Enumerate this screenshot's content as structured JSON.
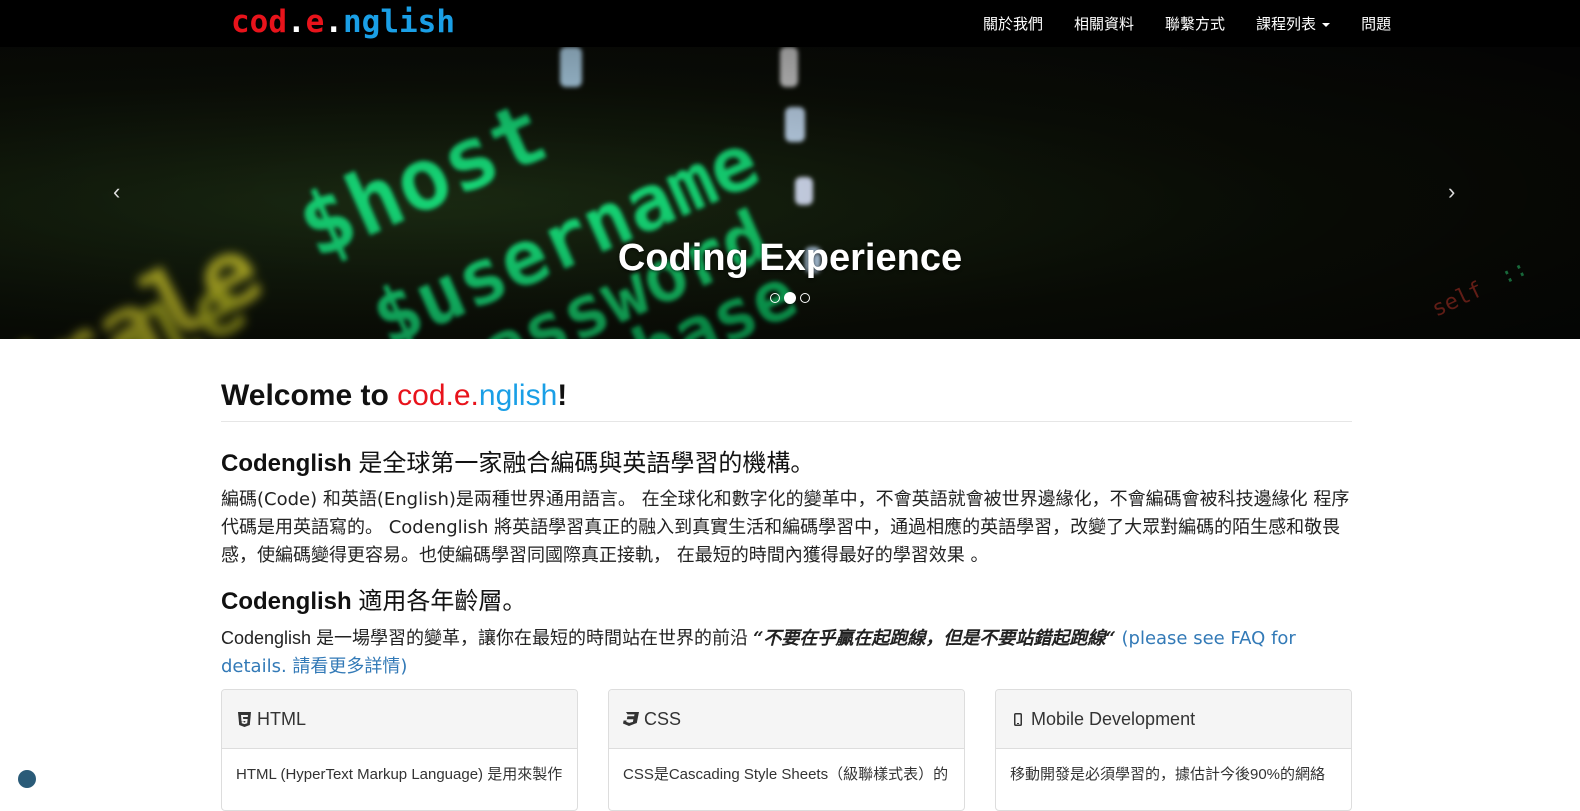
{
  "navbar": {
    "brand": {
      "part1": "cod",
      "dot1": ".",
      "part2": "e",
      "dot2": ".",
      "part3": "nglish"
    },
    "items": [
      "關於我們",
      "相關資料",
      "聯繫方式",
      "課程列表",
      "問題"
    ]
  },
  "carousel": {
    "title": "Coding Experience",
    "prev": "‹",
    "next": "›",
    "slide_count": 3,
    "active_index": 1
  },
  "welcome": {
    "prefix": "Welcome to ",
    "logo_a": "cod.e.",
    "logo_b": "nglish",
    "suffix": "!"
  },
  "section1": {
    "heading_en": "Codenglish ",
    "heading_zh": "是全球第一家融合編碼與英語學習的機構。",
    "paragraph": "編碼(Code) 和英語(English)是兩種世界通用語言。 在全球化和數字化的變革中，不會英語就會被世界邊緣化，不會編碼會被科技邊緣化 程序代碼是用英語寫的。 Codenglish 將英語學習真正的融入到真實生活和編碼學習中，通過相應的英語學習，改變了大眾對編碼的陌生感和敬畏感，使編碼變得更容易。也使編碼學習同國際真正接軌， 在最短的時間內獲得最好的學習效果 。"
  },
  "section2": {
    "heading_en": "Codenglish ",
    "heading_zh": "適用各年齡層。",
    "paragraph_lead": "Codenglish 是一場學習的變革，讓你在最短的時間站在世界的前沿 ",
    "quote": "“不要在乎贏在起跑線，但是不要站錯起跑線“",
    "link": " (please see FAQ for details. 請看更多詳情)"
  },
  "panels": [
    {
      "icon": "html5-icon",
      "title": "HTML",
      "body": "HTML (HyperText Markup Language) 是用來製作"
    },
    {
      "icon": "css3-icon",
      "title": "CSS",
      "body": "CSS是Cascading Style Sheets（級聯樣式表）的"
    },
    {
      "icon": "mobile-icon",
      "title": "Mobile Development",
      "body": "移動開發是必須學習的，據估計今後90%的網絡"
    }
  ],
  "colors": {
    "brand_red": "#e8131b",
    "brand_blue": "#1a9fe6",
    "link": "#337ab7",
    "navbar": "#000000"
  }
}
